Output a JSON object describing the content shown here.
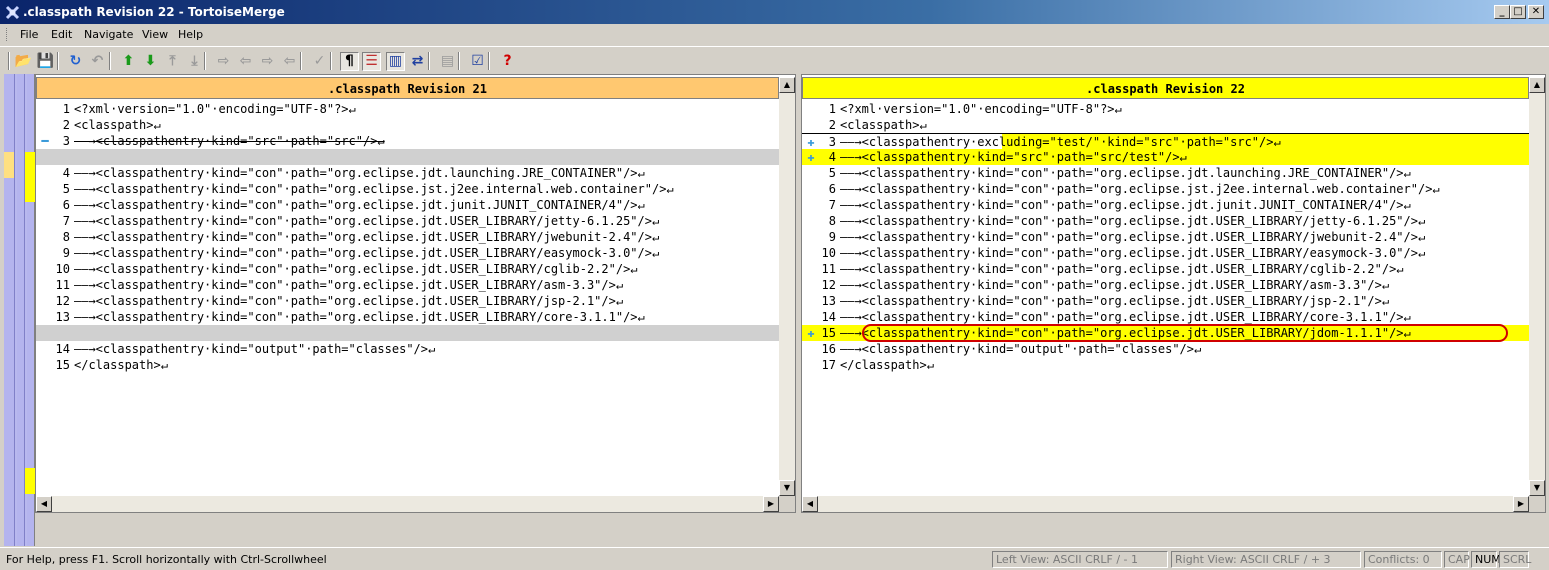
{
  "window": {
    "title": ".classpath Revision 22 - TortoiseMerge",
    "minimize": "_",
    "maximize": "□",
    "close": "✕"
  },
  "menu": [
    "File",
    "Edit",
    "Navigate",
    "View",
    "Help"
  ],
  "toolbar": [
    {
      "name": "open-icon",
      "glyph": "📂"
    },
    {
      "name": "save-icon",
      "glyph": "💾"
    },
    {
      "name": "reload-icon",
      "glyph": "↻"
    },
    {
      "name": "undo-icon",
      "glyph": "↶"
    },
    {
      "name": "next-diff-icon",
      "glyph": "⬆"
    },
    {
      "name": "prev-diff-icon",
      "glyph": "⬇"
    },
    {
      "name": "first-diff-icon",
      "glyph": "⤒"
    },
    {
      "name": "last-diff-icon",
      "glyph": "⤓"
    },
    {
      "name": "use-left-icon",
      "glyph": "⇨"
    },
    {
      "name": "use-right-icon",
      "glyph": "⇦"
    },
    {
      "name": "use-left-first-icon",
      "glyph": "⇨"
    },
    {
      "name": "use-right-first-icon",
      "glyph": "⇦"
    },
    {
      "name": "mark-resolved-icon",
      "glyph": "✓"
    },
    {
      "name": "whitespace-icon",
      "glyph": "¶"
    },
    {
      "name": "inline-diff-icon",
      "glyph": "☰"
    },
    {
      "name": "side-by-side-icon",
      "glyph": "▥"
    },
    {
      "name": "switch-views-icon",
      "glyph": "⇄"
    },
    {
      "name": "patch-icon",
      "glyph": "▤"
    },
    {
      "name": "settings-icon",
      "glyph": "☑"
    },
    {
      "name": "help-icon",
      "glyph": "?"
    }
  ],
  "left": {
    "title": ".classpath Revision 21",
    "rows": [
      {
        "n": "1",
        "t": "<?xml·version=\"1.0\"·encoding=\"UTF-8\"?>↵",
        "k": "normal"
      },
      {
        "n": "2",
        "t": "<classpath>↵",
        "k": "normal"
      },
      {
        "n": "3",
        "t": "——→<classpathentry·kind=\"src\"·path=\"src\"/>↵",
        "k": "removed",
        "g": "━"
      },
      {
        "n": "",
        "t": "",
        "k": "filler"
      },
      {
        "n": "4",
        "t": "——→<classpathentry·kind=\"con\"·path=\"org.eclipse.jdt.launching.JRE_CONTAINER\"/>↵",
        "k": "normal"
      },
      {
        "n": "5",
        "t": "——→<classpathentry·kind=\"con\"·path=\"org.eclipse.jst.j2ee.internal.web.container\"/>↵",
        "k": "normal"
      },
      {
        "n": "6",
        "t": "——→<classpathentry·kind=\"con\"·path=\"org.eclipse.jdt.junit.JUNIT_CONTAINER/4\"/>↵",
        "k": "normal"
      },
      {
        "n": "7",
        "t": "——→<classpathentry·kind=\"con\"·path=\"org.eclipse.jdt.USER_LIBRARY/jetty-6.1.25\"/>↵",
        "k": "normal"
      },
      {
        "n": "8",
        "t": "——→<classpathentry·kind=\"con\"·path=\"org.eclipse.jdt.USER_LIBRARY/jwebunit-2.4\"/>↵",
        "k": "normal"
      },
      {
        "n": "9",
        "t": "——→<classpathentry·kind=\"con\"·path=\"org.eclipse.jdt.USER_LIBRARY/easymock-3.0\"/>↵",
        "k": "normal"
      },
      {
        "n": "10",
        "t": "——→<classpathentry·kind=\"con\"·path=\"org.eclipse.jdt.USER_LIBRARY/cglib-2.2\"/>↵",
        "k": "normal"
      },
      {
        "n": "11",
        "t": "——→<classpathentry·kind=\"con\"·path=\"org.eclipse.jdt.USER_LIBRARY/asm-3.3\"/>↵",
        "k": "normal"
      },
      {
        "n": "12",
        "t": "——→<classpathentry·kind=\"con\"·path=\"org.eclipse.jdt.USER_LIBRARY/jsp-2.1\"/>↵",
        "k": "normal"
      },
      {
        "n": "13",
        "t": "——→<classpathentry·kind=\"con\"·path=\"org.eclipse.jdt.USER_LIBRARY/core-3.1.1\"/>↵",
        "k": "normal"
      },
      {
        "n": "",
        "t": "",
        "k": "filler"
      },
      {
        "n": "14",
        "t": "——→<classpathentry·kind=\"output\"·path=\"classes\"/>↵",
        "k": "normal"
      },
      {
        "n": "15",
        "t": "</classpath>↵",
        "k": "normal"
      }
    ]
  },
  "right": {
    "title": ".classpath Revision 22",
    "rows": [
      {
        "n": "1",
        "t": "<?xml·version=\"1.0\"·encoding=\"UTF-8\"?>↵",
        "k": "normal"
      },
      {
        "n": "2",
        "t": "<classpath>↵",
        "k": "normal"
      },
      {
        "n": "3",
        "t": "——→<classpathentry·excluding=\"test/\"·kind=\"src\"·path=\"src\"/>↵",
        "k": "changed",
        "g": "✚"
      },
      {
        "n": "4",
        "t": "——→<classpathentry·kind=\"src\"·path=\"src/test\"/>↵",
        "k": "added",
        "g": "✚"
      },
      {
        "n": "5",
        "t": "——→<classpathentry·kind=\"con\"·path=\"org.eclipse.jdt.launching.JRE_CONTAINER\"/>↵",
        "k": "normal"
      },
      {
        "n": "6",
        "t": "——→<classpathentry·kind=\"con\"·path=\"org.eclipse.jst.j2ee.internal.web.container\"/>↵",
        "k": "normal"
      },
      {
        "n": "7",
        "t": "——→<classpathentry·kind=\"con\"·path=\"org.eclipse.jdt.junit.JUNIT_CONTAINER/4\"/>↵",
        "k": "normal"
      },
      {
        "n": "8",
        "t": "——→<classpathentry·kind=\"con\"·path=\"org.eclipse.jdt.USER_LIBRARY/jetty-6.1.25\"/>↵",
        "k": "normal"
      },
      {
        "n": "9",
        "t": "——→<classpathentry·kind=\"con\"·path=\"org.eclipse.jdt.USER_LIBRARY/jwebunit-2.4\"/>↵",
        "k": "normal"
      },
      {
        "n": "10",
        "t": "——→<classpathentry·kind=\"con\"·path=\"org.eclipse.jdt.USER_LIBRARY/easymock-3.0\"/>↵",
        "k": "normal"
      },
      {
        "n": "11",
        "t": "——→<classpathentry·kind=\"con\"·path=\"org.eclipse.jdt.USER_LIBRARY/cglib-2.2\"/>↵",
        "k": "normal"
      },
      {
        "n": "12",
        "t": "——→<classpathentry·kind=\"con\"·path=\"org.eclipse.jdt.USER_LIBRARY/asm-3.3\"/>↵",
        "k": "normal"
      },
      {
        "n": "13",
        "t": "——→<classpathentry·kind=\"con\"·path=\"org.eclipse.jdt.USER_LIBRARY/jsp-2.1\"/>↵",
        "k": "normal"
      },
      {
        "n": "14",
        "t": "——→<classpathentry·kind=\"con\"·path=\"org.eclipse.jdt.USER_LIBRARY/core-3.1.1\"/>↵",
        "k": "normal"
      },
      {
        "n": "15",
        "t": "——→<classpathentry·kind=\"con\"·path=\"org.eclipse.jdt.USER_LIBRARY/jdom-1.1.1\"/>↵",
        "k": "added",
        "g": "✚",
        "ring": true
      },
      {
        "n": "16",
        "t": "——→<classpathentry·kind=\"output\"·path=\"classes\"/>↵",
        "k": "normal"
      },
      {
        "n": "17",
        "t": "</classpath>↵",
        "k": "normal"
      }
    ]
  },
  "status": {
    "help": "For Help, press F1. Scroll horizontally with Ctrl-Scrollwheel",
    "left_view": "Left View: ASCII CRLF  / - 1",
    "right_view": "Right View: ASCII CRLF  / + 3",
    "conflicts": "Conflicts: 0",
    "cap": "CAP",
    "num": "NUM",
    "scrl": "SCRL"
  },
  "colors": {
    "left_header": "#ffc870",
    "right_header": "#ffff00",
    "added": "#ffff00",
    "filler": "#d0d0d0",
    "locator": "#b4b4ee"
  }
}
